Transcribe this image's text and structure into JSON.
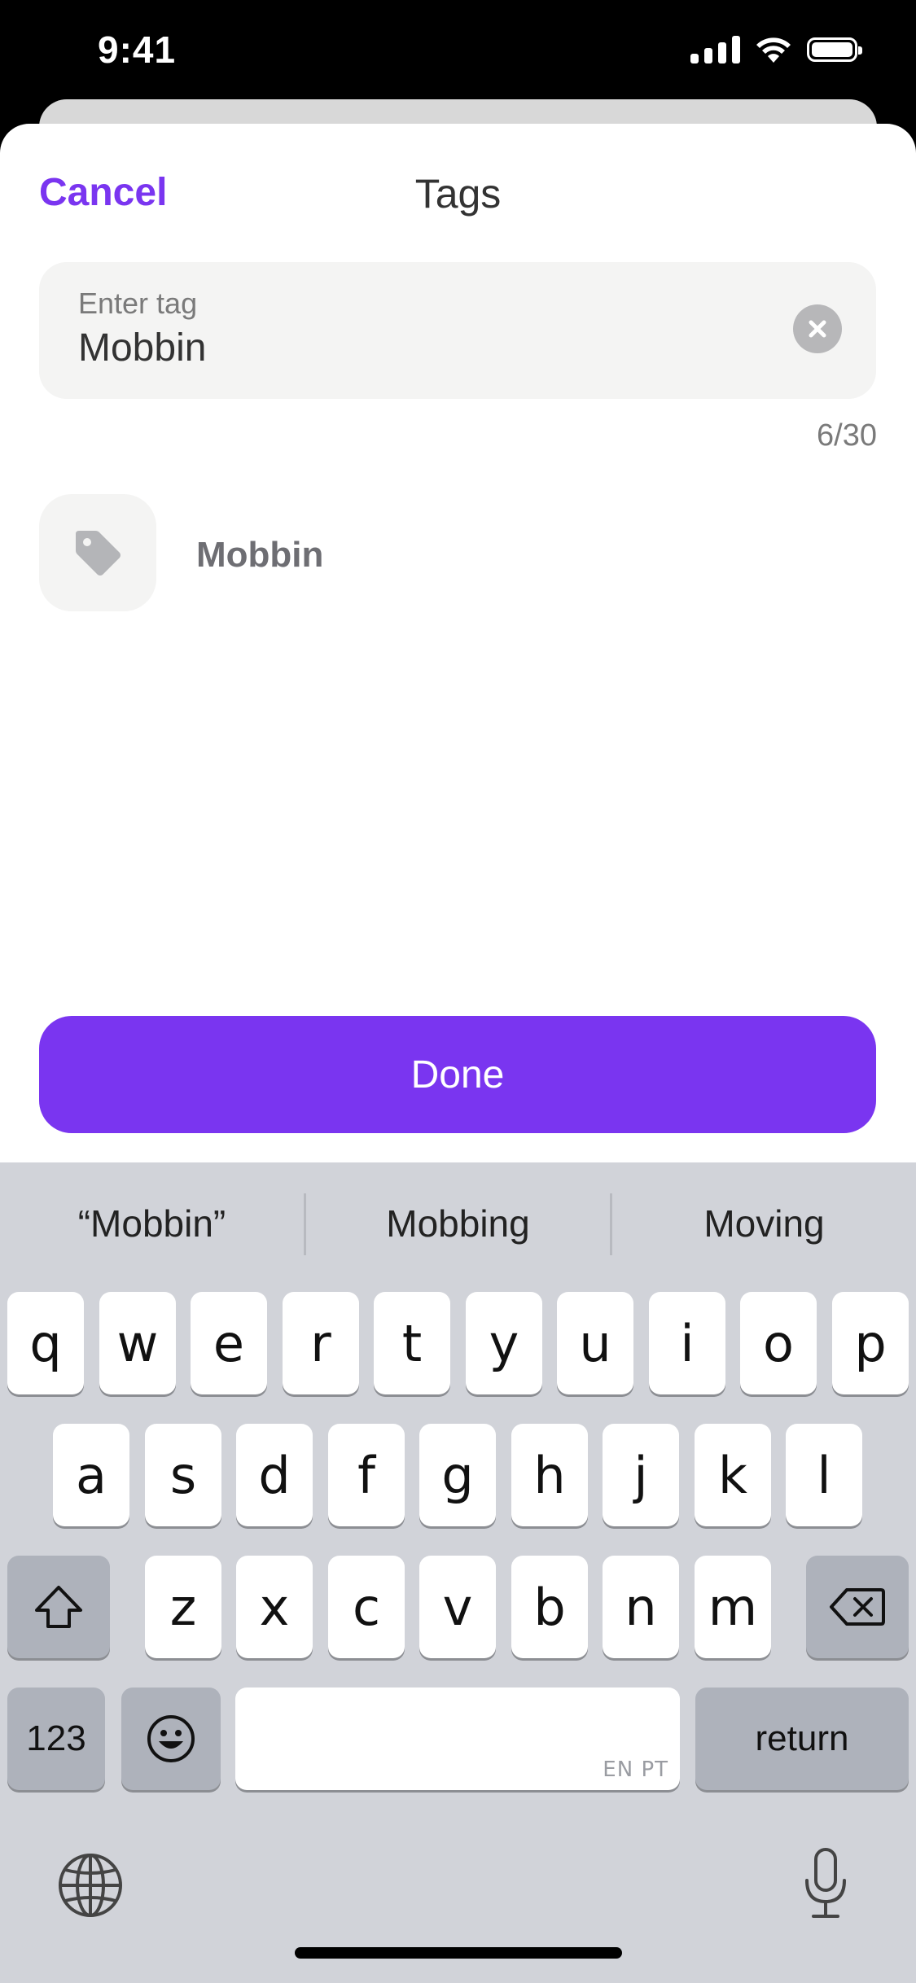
{
  "status_bar": {
    "time": "9:41",
    "icons": [
      "cellular-signal-icon",
      "wifi-icon",
      "battery-icon"
    ]
  },
  "header": {
    "cancel_label": "Cancel",
    "title": "Tags"
  },
  "tag_input": {
    "label": "Enter tag",
    "value": "Mobbin",
    "char_count": "6/30",
    "clear_icon": "clear-circle-icon"
  },
  "suggestion": {
    "icon": "tag-icon",
    "label": "Mobbin"
  },
  "done_label": "Done",
  "keyboard": {
    "predictions": [
      "“Mobbin”",
      "Mobbing",
      "Moving"
    ],
    "row1": [
      "q",
      "w",
      "e",
      "r",
      "t",
      "y",
      "u",
      "i",
      "o",
      "p"
    ],
    "row2": [
      "a",
      "s",
      "d",
      "f",
      "g",
      "h",
      "j",
      "k",
      "l"
    ],
    "row3": [
      "z",
      "x",
      "c",
      "v",
      "b",
      "n",
      "m"
    ],
    "numbers_label": "123",
    "space_hint": "EN PT",
    "return_label": "return"
  },
  "colors": {
    "accent": "#7a35f0",
    "keyboard_bg": "#d1d3d9",
    "field_bg": "#f4f4f3"
  }
}
